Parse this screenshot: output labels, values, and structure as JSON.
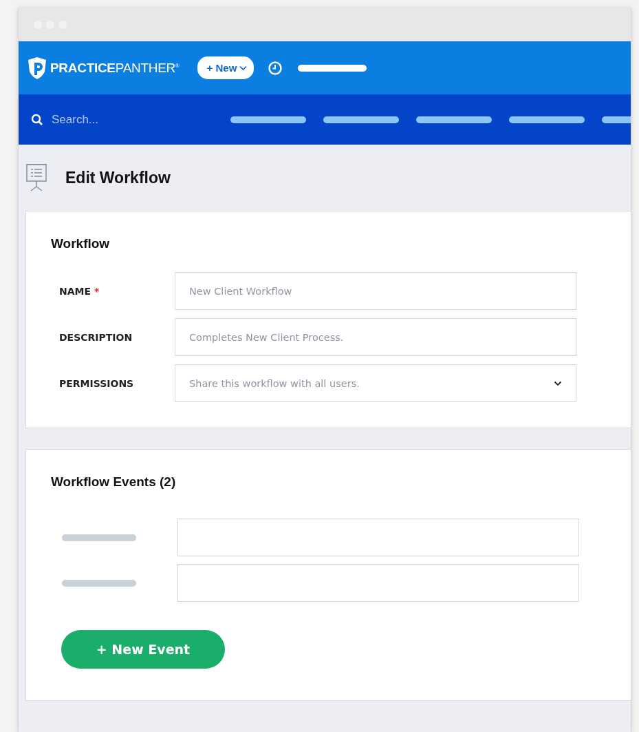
{
  "header": {
    "logo": "**PRACTICE**PANTHER$^{®}$",
    "new_button": "+ New"
  },
  "search": {
    "placeholder": "Search..."
  },
  "page": {
    "title": "Edit Workflow"
  },
  "workflow": {
    "title": "Workflow",
    "fields": [
      {
        "kind": "text",
        "label": "NAME",
        "required_mark": "*",
        "placeholder": "New Client Workflow"
      },
      {
        "kind": "text",
        "label": "DESCRIPTION",
        "placeholder": "Completes New Client Process."
      },
      {
        "kind": "select",
        "label": "PERMISSIONS",
        "value": "Share this workflow with all users."
      }
    ]
  },
  "events": {
    "title": "Workflow Events (2)",
    "button": "+ New Event"
  }
}
